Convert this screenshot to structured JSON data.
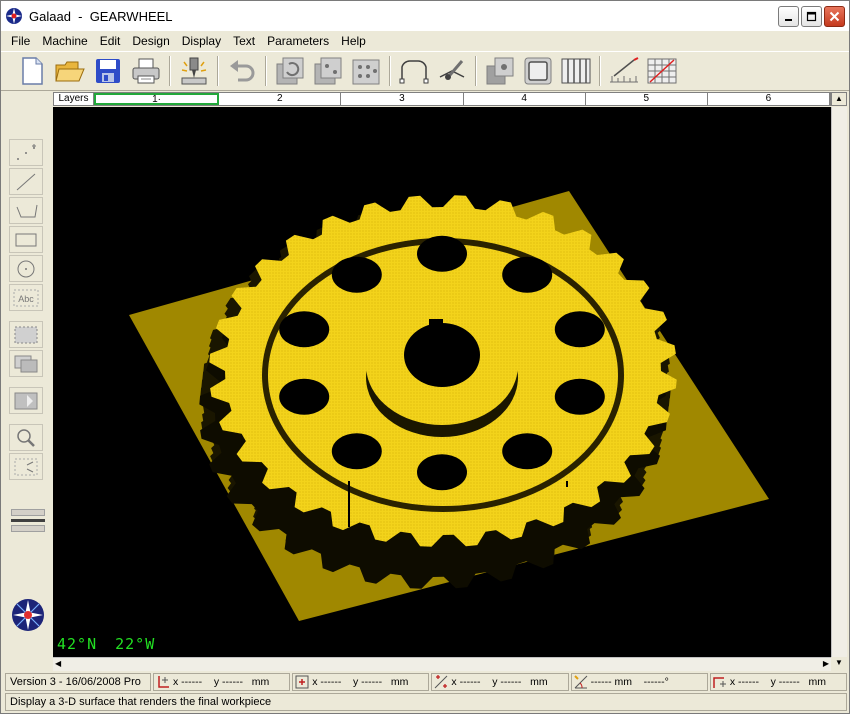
{
  "window": {
    "title": "Galaad  -  GEARWHEEL"
  },
  "menu": [
    "File",
    "Machine",
    "Edit",
    "Design",
    "Display",
    "Text",
    "Parameters",
    "Help"
  ],
  "toolbar": {
    "icons": [
      "new-file-icon",
      "open-folder-icon",
      "save-icon",
      "print-icon",
      "machining-icon",
      "undo-icon",
      "rotate-icon",
      "mirror-icon",
      "matrix-icon",
      "arc-icon",
      "brush-icon",
      "copy-layers-icon",
      "frame-icon",
      "grid-lines-icon",
      "measure-icon",
      "grid-icon"
    ]
  },
  "layers": {
    "label": "Layers",
    "cells": [
      "1·",
      "2",
      "3",
      "4",
      "5",
      "6"
    ],
    "active_index": 0,
    "active_color": "#22a83a"
  },
  "viewport": {
    "angle_north": "42°N",
    "angle_west": "22°W",
    "readout_color": "#22e022",
    "gear_color": "#f2d21a",
    "plate_color": "#a08800"
  },
  "status": {
    "version": "Version 3 - 16/06/2008  Pro",
    "coords": [
      {
        "icon": "origin-point-icon",
        "text": "x ------    y ------   mm"
      },
      {
        "icon": "point-icon",
        "text": "x ------    y ------   mm"
      },
      {
        "icon": "delta-icon",
        "text": "x ------    y ------   mm"
      },
      {
        "icon": "distance-angle-icon",
        "text": "------ mm    ------°"
      },
      {
        "icon": "corner-point-icon",
        "text": "x ------    y ------   mm"
      }
    ],
    "hint": "Display a 3-D surface that renders the final workpiece"
  }
}
